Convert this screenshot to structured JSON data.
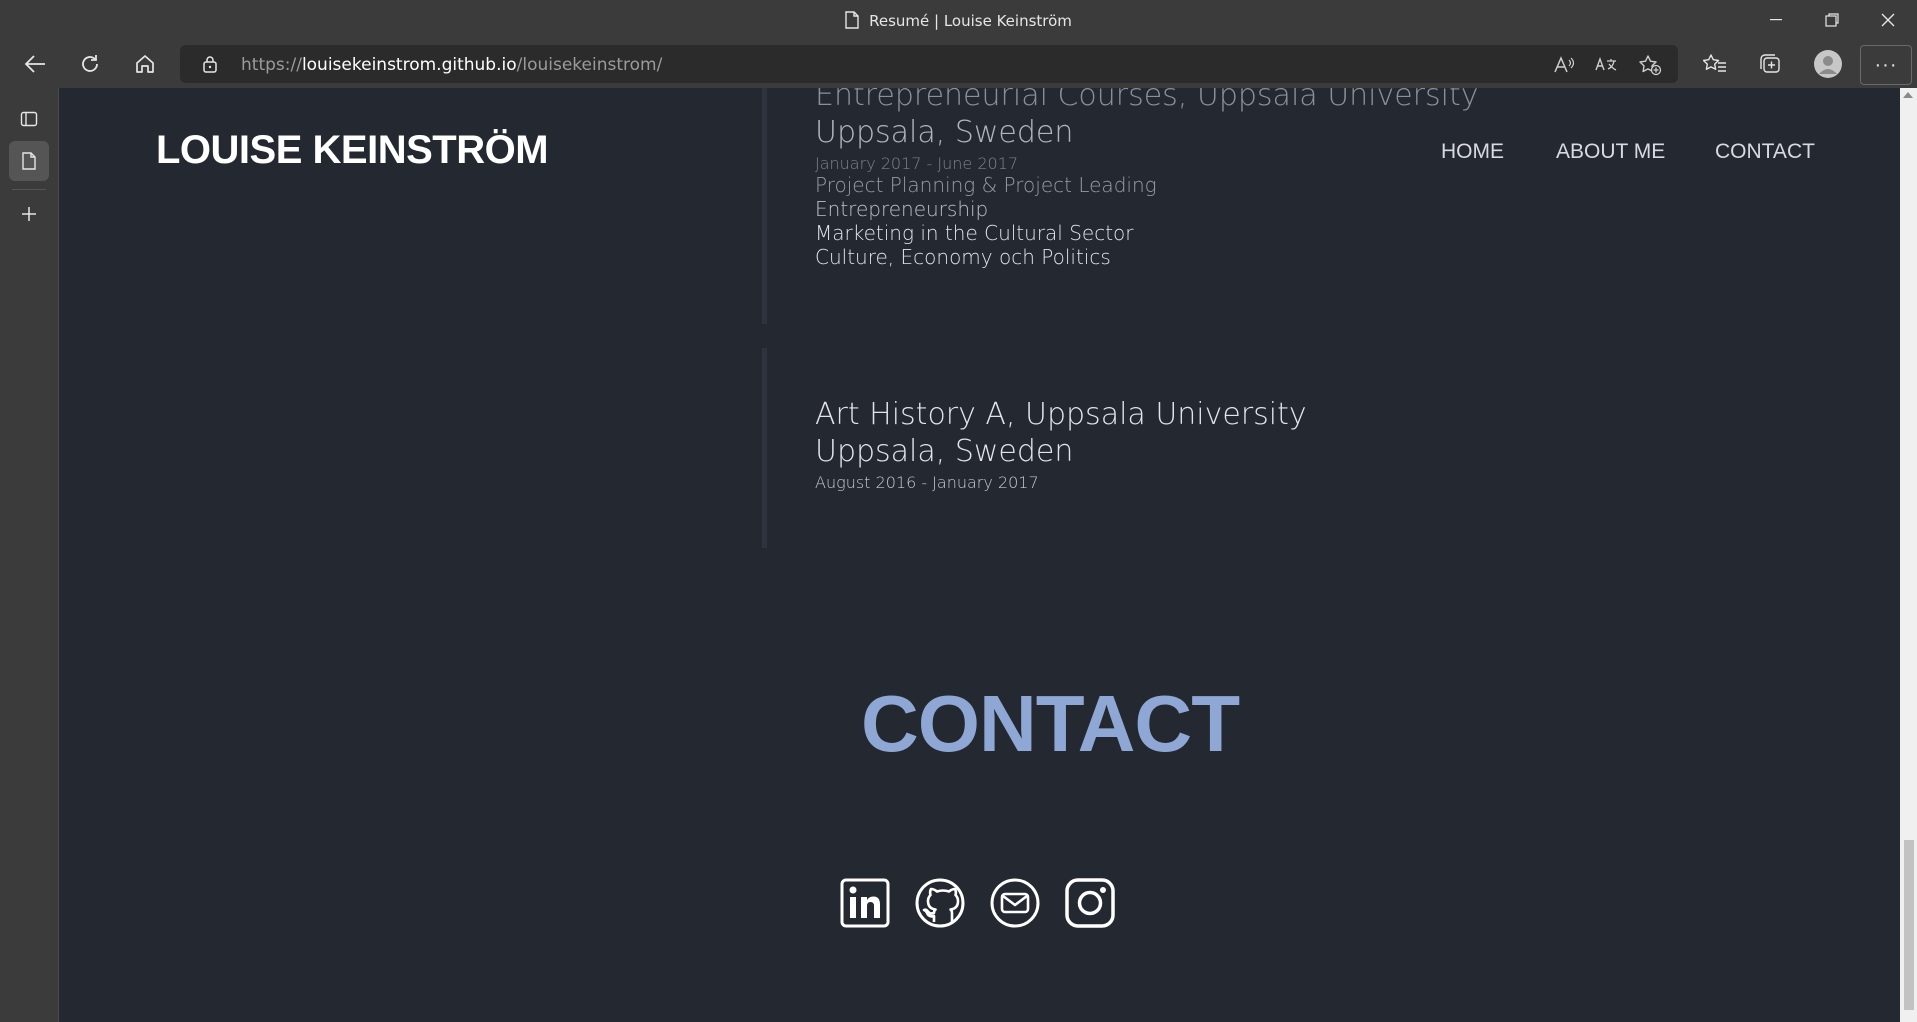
{
  "browser": {
    "window_title": "Resumé | Louise Keinström",
    "url_prefix": "https://",
    "url_host": "louisekeinstrom.github.io",
    "url_path": "/louisekeinstrom/",
    "more_label": "···"
  },
  "site": {
    "brand": "LOUISE KEINSTRÖM",
    "nav": [
      "HOME",
      "ABOUT ME",
      "CONTACT"
    ]
  },
  "education": [
    {
      "title": "Entrepreneurial Courses, Uppsala University",
      "location": "Uppsala, Sweden",
      "dates": "January 2017 - June 2017",
      "courses": [
        "Project Planning & Project Leading",
        "Entrepreneurship",
        "Marketing in the Cultural Sector",
        "Culture, Economy och Politics"
      ]
    },
    {
      "title": "Art History A, Uppsala University",
      "location": "Uppsala, Sweden",
      "dates": "August 2016 - January 2017"
    }
  ],
  "contact": {
    "heading": "CONTACT",
    "socials": [
      "linkedin-icon",
      "github-icon",
      "mail-icon",
      "instagram-icon"
    ]
  },
  "colors": {
    "page_bg": "#242831",
    "contact_heading": "#8ea7d4",
    "browser_chrome": "#3b3b3b"
  }
}
